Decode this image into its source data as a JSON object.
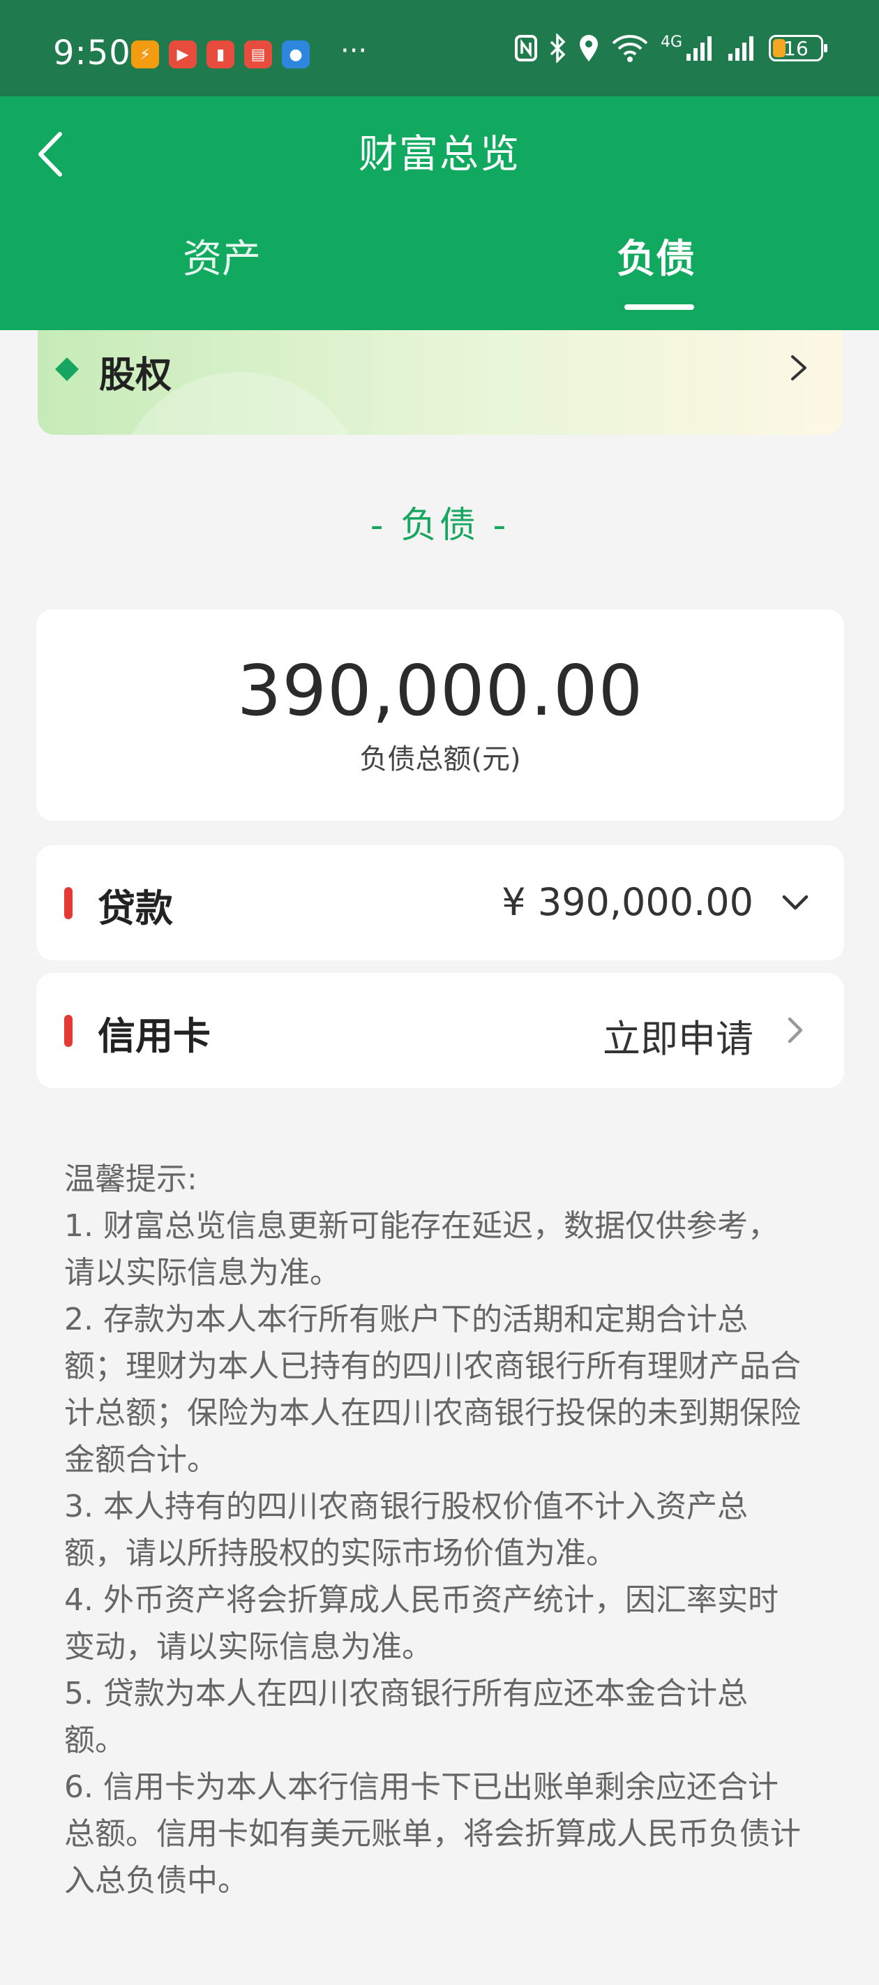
{
  "status_bar": {
    "time": "9:50",
    "more": "···",
    "battery": "16",
    "network": "4G"
  },
  "header": {
    "title": "财富总览",
    "tabs": [
      {
        "label": "资产",
        "active": false
      },
      {
        "label": "负债",
        "active": true
      }
    ]
  },
  "equity": {
    "label": "股权"
  },
  "section": {
    "title": "- 负债 -"
  },
  "total": {
    "amount": "390,000.00",
    "label": "负债总额(元)"
  },
  "rows": [
    {
      "label": "贷款",
      "value": "¥ 390,000.00"
    },
    {
      "label": "信用卡",
      "value": "立即申请"
    }
  ],
  "tips": {
    "heading": "温馨提示:",
    "items": [
      "1. 财富总览信息更新可能存在延迟，数据仅供参考，请以实际信息为准。",
      "2. 存款为本人本行所有账户下的活期和定期合计总额；理财为本人已持有的四川农商银行所有理财产品合计总额；保险为本人在四川农商银行投保的未到期保险金额合计。",
      "3. 本人持有的四川农商银行股权价值不计入资产总额，请以所持股权的实际市场价值为准。",
      "4. 外币资产将会折算成人民币资产统计，因汇率实时变动，请以实际信息为准。",
      "5. 贷款为本人在四川农商银行所有应还本金合计总额。",
      "6. 信用卡为本人本行信用卡下已出账单剩余应还合计总额。信用卡如有美元账单，将会折算成人民币负债计入总负债中。"
    ]
  },
  "colors": {
    "header_green": "#11a85f",
    "status_green": "#1f7a4d",
    "accent_green": "#17a660",
    "red_marker": "#e53935"
  }
}
